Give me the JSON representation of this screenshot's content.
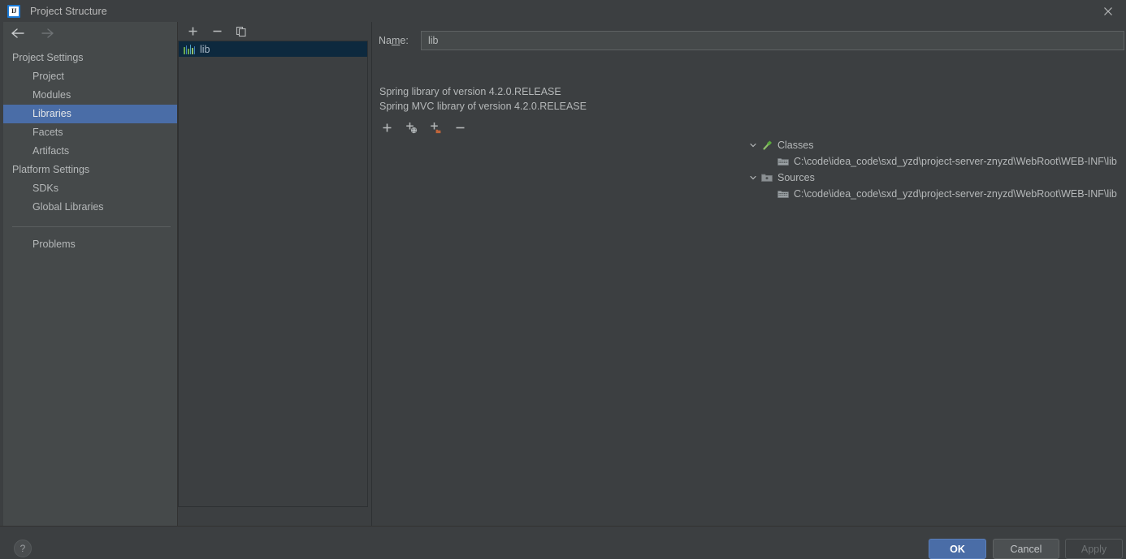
{
  "window": {
    "title": "Project Structure",
    "logo_text": "IJ",
    "close_icon": "close-icon"
  },
  "nav": {
    "back_icon": "arrow-left-icon",
    "forward_icon": "arrow-right-icon"
  },
  "sidebar": {
    "groups": [
      {
        "label": "Project Settings",
        "items": [
          {
            "label": "Project",
            "selected": false
          },
          {
            "label": "Modules",
            "selected": false
          },
          {
            "label": "Libraries",
            "selected": true
          },
          {
            "label": "Facets",
            "selected": false
          },
          {
            "label": "Artifacts",
            "selected": false
          }
        ]
      },
      {
        "label": "Platform Settings",
        "items": [
          {
            "label": "SDKs",
            "selected": false
          },
          {
            "label": "Global Libraries",
            "selected": false
          }
        ]
      }
    ],
    "extra_items": [
      {
        "label": "Problems",
        "selected": false
      }
    ]
  },
  "mid_panel": {
    "toolbar": [
      {
        "name": "add-library-button",
        "glyph": "plus"
      },
      {
        "name": "remove-library-button",
        "glyph": "minus"
      },
      {
        "name": "copy-library-button",
        "glyph": "copy"
      }
    ],
    "libraries": [
      {
        "label": "lib",
        "selected": true,
        "icon": "library-icon"
      }
    ]
  },
  "right_panel": {
    "name_label_pre": "Na",
    "name_label_mnemonic": "m",
    "name_label_post": "e:",
    "name_value": "lib",
    "name_placeholder": "",
    "descriptions": [
      "Spring library of version 4.2.0.RELEASE",
      "Spring MVC library of version 4.2.0.RELEASE"
    ],
    "toolbar": [
      {
        "name": "add-root-button",
        "glyph": "plus"
      },
      {
        "name": "add-maven-root-button",
        "glyph": "plus-globe"
      },
      {
        "name": "add-directory-root-button",
        "glyph": "plus-folder"
      },
      {
        "name": "remove-root-button",
        "glyph": "minus"
      }
    ],
    "tree": [
      {
        "label": "Classes",
        "icon": "classes-hammer-icon",
        "expanded": true,
        "children": [
          {
            "label": "C:\\code\\idea_code\\sxd_yzd\\project-server-znyzd\\WebRoot\\WEB-INF\\lib",
            "icon": "archive-folder-icon"
          }
        ]
      },
      {
        "label": "Sources",
        "icon": "sources-folder-icon",
        "expanded": true,
        "children": [
          {
            "label": "C:\\code\\idea_code\\sxd_yzd\\project-server-znyzd\\WebRoot\\WEB-INF\\lib",
            "icon": "archive-folder-icon"
          }
        ]
      }
    ]
  },
  "footer": {
    "help_label": "?",
    "ok_label": "OK",
    "cancel_label": "Cancel",
    "apply_label": "Apply",
    "apply_enabled": false
  },
  "colors": {
    "dialog_bg": "#3c3f41",
    "sidebar_bg": "#45494a",
    "selection_blue": "#4a6da7",
    "list_selection": "#0d293e",
    "text": "#b5b8b9",
    "accent_green": "#6aa84f",
    "accent_orange": "#c0653a"
  }
}
